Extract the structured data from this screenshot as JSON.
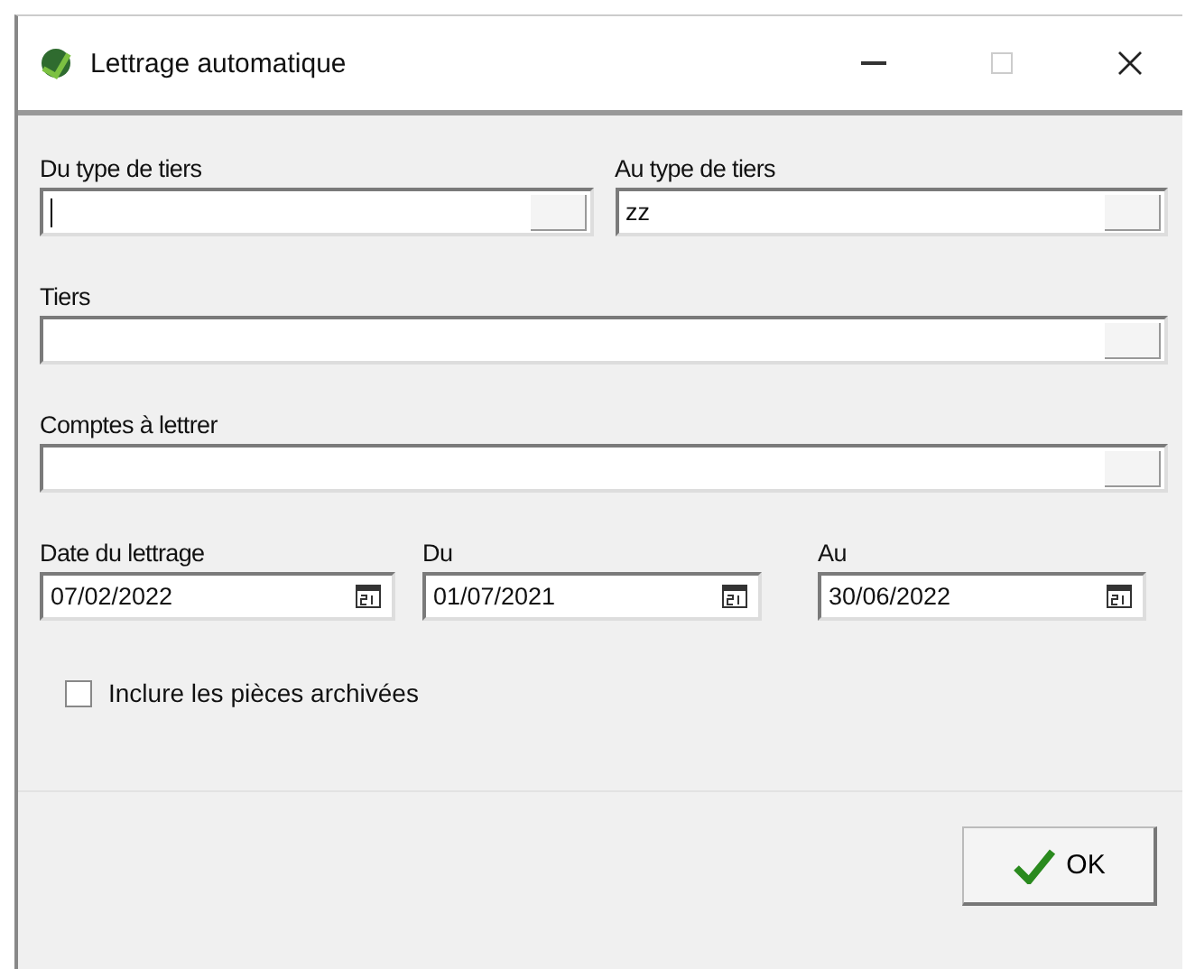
{
  "window": {
    "title": "Lettrage automatique"
  },
  "type_fields": [
    {
      "label": "Du type de tiers",
      "focused": true
    },
    {
      "label": "Au type de tiers",
      "value": "zz",
      "focused": false
    }
  ],
  "lookup_fields": [
    {
      "label": "Tiers"
    },
    {
      "label": "Comptes à lettrer"
    }
  ],
  "date_fields": [
    {
      "label": "Date du lettrage",
      "value": "07/02/2022"
    },
    {
      "label": "Du",
      "value": "01/07/2021"
    },
    {
      "label": "Au",
      "value": "30/06/2022"
    }
  ],
  "archive_checkbox": {
    "label": "Inclure les pièces archivées",
    "checked": false
  },
  "ok_button": {
    "label": "OK"
  }
}
